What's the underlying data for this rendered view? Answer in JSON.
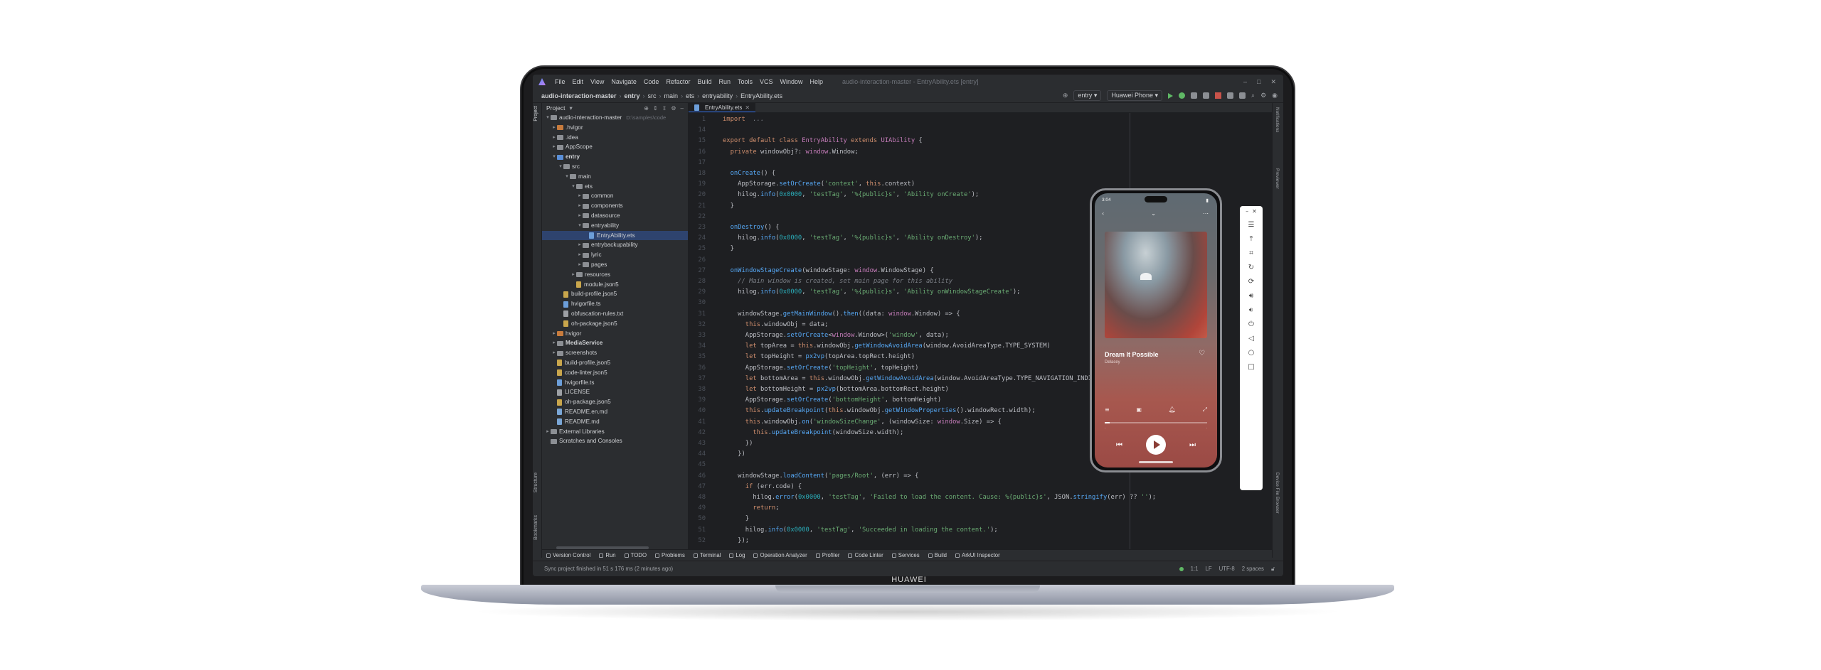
{
  "ide": {
    "menu": [
      "File",
      "Edit",
      "View",
      "Navigate",
      "Code",
      "Refactor",
      "Build",
      "Run",
      "Tools",
      "VCS",
      "Window",
      "Help"
    ],
    "window_title": "audio-interaction-master - EntryAbility.ets [entry]",
    "breadcrumb": [
      "audio-interaction-master",
      "entry",
      "src",
      "main",
      "ets",
      "entryability",
      "EntryAbility.ets"
    ],
    "run_config": "entry",
    "device": "Huawei Phone",
    "project_label": "Project",
    "tab_label": "EntryAbility.ets"
  },
  "tree": [
    {
      "indent": 0,
      "chev": "v",
      "icon": "folder",
      "label": "audio-interaction-master",
      "hint": "D:\\samples\\code"
    },
    {
      "indent": 1,
      "chev": ">",
      "icon": "folder-orange",
      "label": ".hvigor"
    },
    {
      "indent": 1,
      "chev": ">",
      "icon": "folder",
      "label": ".idea"
    },
    {
      "indent": 1,
      "chev": ">",
      "icon": "folder",
      "label": "AppScope"
    },
    {
      "indent": 1,
      "chev": "v",
      "icon": "folder-blue",
      "label": "entry"
    },
    {
      "indent": 2,
      "chev": "v",
      "icon": "folder",
      "label": "src"
    },
    {
      "indent": 3,
      "chev": "v",
      "icon": "folder",
      "label": "main"
    },
    {
      "indent": 4,
      "chev": "v",
      "icon": "folder",
      "label": "ets"
    },
    {
      "indent": 5,
      "chev": ">",
      "icon": "folder",
      "label": "common"
    },
    {
      "indent": 5,
      "chev": ">",
      "icon": "folder",
      "label": "components"
    },
    {
      "indent": 5,
      "chev": ">",
      "icon": "folder",
      "label": "datasource"
    },
    {
      "indent": 5,
      "chev": "v",
      "icon": "folder",
      "label": "entryability"
    },
    {
      "indent": 6,
      "chev": "",
      "icon": "file",
      "label": "EntryAbility.ets",
      "selected": true
    },
    {
      "indent": 5,
      "chev": ">",
      "icon": "folder",
      "label": "entrybackupability"
    },
    {
      "indent": 5,
      "chev": ">",
      "icon": "folder",
      "label": "lyric"
    },
    {
      "indent": 5,
      "chev": ">",
      "icon": "folder",
      "label": "pages"
    },
    {
      "indent": 4,
      "chev": ">",
      "icon": "folder",
      "label": "resources"
    },
    {
      "indent": 4,
      "chev": "",
      "icon": "json",
      "label": "module.json5"
    },
    {
      "indent": 2,
      "chev": "",
      "icon": "json",
      "label": "build-profile.json5"
    },
    {
      "indent": 2,
      "chev": "",
      "icon": "file",
      "label": "hvigorfile.ts"
    },
    {
      "indent": 2,
      "chev": "",
      "icon": "txt",
      "label": "obfuscation-rules.txt"
    },
    {
      "indent": 2,
      "chev": "",
      "icon": "json",
      "label": "oh-package.json5"
    },
    {
      "indent": 1,
      "chev": ">",
      "icon": "folder-orange",
      "label": "hvigor"
    },
    {
      "indent": 1,
      "chev": ">",
      "icon": "folder",
      "label": "MediaService"
    },
    {
      "indent": 1,
      "chev": ">",
      "icon": "folder",
      "label": "screenshots"
    },
    {
      "indent": 1,
      "chev": "",
      "icon": "json",
      "label": "build-profile.json5"
    },
    {
      "indent": 1,
      "chev": "",
      "icon": "json",
      "label": "code-linter.json5"
    },
    {
      "indent": 1,
      "chev": "",
      "icon": "file",
      "label": "hvigorfile.ts"
    },
    {
      "indent": 1,
      "chev": "",
      "icon": "txt",
      "label": "LICENSE"
    },
    {
      "indent": 1,
      "chev": "",
      "icon": "json",
      "label": "oh-package.json5"
    },
    {
      "indent": 1,
      "chev": "",
      "icon": "md",
      "label": "README.en.md"
    },
    {
      "indent": 1,
      "chev": "",
      "icon": "md",
      "label": "README.md"
    },
    {
      "indent": 0,
      "chev": ">",
      "icon": "folder",
      "label": "External Libraries"
    },
    {
      "indent": 0,
      "chev": "",
      "icon": "folder",
      "label": "Scratches and Consoles"
    }
  ],
  "code": [
    {
      "n": "",
      "t": [
        [
          "kw",
          "import"
        ],
        [
          "",
          "  "
        ],
        [
          "cmt",
          "..."
        ]
      ]
    },
    {
      "n": "",
      "t": []
    },
    {
      "n": "",
      "t": [
        [
          "kw",
          "export default class "
        ],
        [
          "typ",
          "EntryAbility "
        ],
        [
          "kw",
          "extends "
        ],
        [
          "typ",
          "UIAbility"
        ],
        [
          "",
          " {"
        ]
      ]
    },
    {
      "n": "",
      "t": [
        [
          "",
          "  "
        ],
        [
          "kw",
          "private "
        ],
        [
          "",
          "windowObj?: "
        ],
        [
          "typ",
          "window"
        ],
        [
          "",
          ".Window;"
        ]
      ]
    },
    {
      "n": "",
      "t": []
    },
    {
      "n": "",
      "t": [
        [
          "",
          "  "
        ],
        [
          "fn",
          "onCreate"
        ],
        [
          "",
          "() {"
        ]
      ]
    },
    {
      "n": "",
      "t": [
        [
          "",
          "    AppStorage."
        ],
        [
          "fn",
          "setOrCreate"
        ],
        [
          "",
          "("
        ],
        [
          "str",
          "'context'"
        ],
        [
          "",
          ", "
        ],
        [
          "kw",
          "this"
        ],
        [
          "",
          ".context)"
        ]
      ]
    },
    {
      "n": "",
      "t": [
        [
          "",
          "    hilog."
        ],
        [
          "fn",
          "info"
        ],
        [
          "",
          "("
        ],
        [
          "num",
          "0x0000"
        ],
        [
          "",
          ", "
        ],
        [
          "str",
          "'testTag'"
        ],
        [
          "",
          ", "
        ],
        [
          "str",
          "'%{public}s'"
        ],
        [
          "",
          ", "
        ],
        [
          "str",
          "'Ability onCreate'"
        ],
        [
          "",
          ");"
        ]
      ]
    },
    {
      "n": "",
      "t": [
        [
          "",
          "  }"
        ]
      ]
    },
    {
      "n": "",
      "t": []
    },
    {
      "n": "",
      "t": [
        [
          "",
          "  "
        ],
        [
          "fn",
          "onDestroy"
        ],
        [
          "",
          "() {"
        ]
      ]
    },
    {
      "n": "",
      "t": [
        [
          "",
          "    hilog."
        ],
        [
          "fn",
          "info"
        ],
        [
          "",
          "("
        ],
        [
          "num",
          "0x0000"
        ],
        [
          "",
          ", "
        ],
        [
          "str",
          "'testTag'"
        ],
        [
          "",
          ", "
        ],
        [
          "str",
          "'%{public}s'"
        ],
        [
          "",
          ", "
        ],
        [
          "str",
          "'Ability onDestroy'"
        ],
        [
          "",
          ");"
        ]
      ]
    },
    {
      "n": "",
      "t": [
        [
          "",
          "  }"
        ]
      ]
    },
    {
      "n": "",
      "t": []
    },
    {
      "n": "",
      "t": [
        [
          "",
          "  "
        ],
        [
          "fn",
          "onWindowStageCreate"
        ],
        [
          "",
          "(windowStage: "
        ],
        [
          "typ",
          "window"
        ],
        [
          "",
          ".WindowStage) {"
        ]
      ]
    },
    {
      "n": "",
      "t": [
        [
          "cmt",
          "    // Main window is created, set main page for this ability"
        ]
      ]
    },
    {
      "n": "",
      "t": [
        [
          "",
          "    hilog."
        ],
        [
          "fn",
          "info"
        ],
        [
          "",
          "("
        ],
        [
          "num",
          "0x0000"
        ],
        [
          "",
          ", "
        ],
        [
          "str",
          "'testTag'"
        ],
        [
          "",
          ", "
        ],
        [
          "str",
          "'%{public}s'"
        ],
        [
          "",
          ", "
        ],
        [
          "str",
          "'Ability onWindowStageCreate'"
        ],
        [
          "",
          ");"
        ]
      ]
    },
    {
      "n": "",
      "t": []
    },
    {
      "n": "",
      "t": [
        [
          "",
          "    windowStage."
        ],
        [
          "fn",
          "getMainWindow"
        ],
        [
          "",
          "()."
        ],
        [
          "fn",
          "then"
        ],
        [
          "",
          "((data: "
        ],
        [
          "typ",
          "window"
        ],
        [
          "",
          ".Window) => {"
        ]
      ]
    },
    {
      "n": "",
      "t": [
        [
          "",
          "      "
        ],
        [
          "kw",
          "this"
        ],
        [
          "",
          ".windowObj = data;"
        ]
      ]
    },
    {
      "n": "",
      "t": [
        [
          "",
          "      AppStorage."
        ],
        [
          "fn",
          "setOrCreate"
        ],
        [
          "",
          "<"
        ],
        [
          "typ",
          "window"
        ],
        [
          "",
          ".Window>("
        ],
        [
          "str",
          "'window'"
        ],
        [
          "",
          ", data);"
        ]
      ]
    },
    {
      "n": "",
      "t": [
        [
          "",
          "      "
        ],
        [
          "kw",
          "let "
        ],
        [
          "",
          "topArea = "
        ],
        [
          "kw",
          "this"
        ],
        [
          "",
          ".windowObj."
        ],
        [
          "fn",
          "getWindowAvoidArea"
        ],
        [
          "",
          "(window.AvoidAreaType.TYPE_SYSTEM)"
        ]
      ]
    },
    {
      "n": "",
      "t": [
        [
          "",
          "      "
        ],
        [
          "kw",
          "let "
        ],
        [
          "",
          "topHeight = "
        ],
        [
          "fn",
          "px2vp"
        ],
        [
          "",
          "(topArea.topRect.height)"
        ]
      ]
    },
    {
      "n": "",
      "t": [
        [
          "",
          "      AppStorage."
        ],
        [
          "fn",
          "setOrCreate"
        ],
        [
          "",
          "("
        ],
        [
          "str",
          "'topHeight'"
        ],
        [
          "",
          ", topHeight)"
        ]
      ]
    },
    {
      "n": "",
      "t": [
        [
          "",
          "      "
        ],
        [
          "kw",
          "let "
        ],
        [
          "",
          "bottomArea = "
        ],
        [
          "kw",
          "this"
        ],
        [
          "",
          ".windowObj."
        ],
        [
          "fn",
          "getWindowAvoidArea"
        ],
        [
          "",
          "(window.AvoidAreaType.TYPE_NAVIGATION_INDICATOR)"
        ]
      ]
    },
    {
      "n": "",
      "t": [
        [
          "",
          "      "
        ],
        [
          "kw",
          "let "
        ],
        [
          "",
          "bottomHeight = "
        ],
        [
          "fn",
          "px2vp"
        ],
        [
          "",
          "(bottomArea.bottomRect.height)"
        ]
      ]
    },
    {
      "n": "",
      "t": [
        [
          "",
          "      AppStorage."
        ],
        [
          "fn",
          "setOrCreate"
        ],
        [
          "",
          "("
        ],
        [
          "str",
          "'bottomHeight'"
        ],
        [
          "",
          ", bottomHeight)"
        ]
      ]
    },
    {
      "n": "",
      "t": [
        [
          "",
          "      "
        ],
        [
          "kw",
          "this"
        ],
        [
          "",
          "."
        ],
        [
          "fn",
          "updateBreakpoint"
        ],
        [
          "",
          "("
        ],
        [
          "kw",
          "this"
        ],
        [
          "",
          ".windowObj."
        ],
        [
          "fn",
          "getWindowProperties"
        ],
        [
          "",
          "().windowRect.width);"
        ]
      ]
    },
    {
      "n": "",
      "t": [
        [
          "",
          "      "
        ],
        [
          "kw",
          "this"
        ],
        [
          "",
          ".windowObj."
        ],
        [
          "fn",
          "on"
        ],
        [
          "",
          "("
        ],
        [
          "str",
          "'windowSizeChange'"
        ],
        [
          "",
          ", (windowSize: "
        ],
        [
          "typ",
          "window"
        ],
        [
          "",
          ".Size) => {"
        ]
      ]
    },
    {
      "n": "",
      "t": [
        [
          "",
          "        "
        ],
        [
          "kw",
          "this"
        ],
        [
          "",
          "."
        ],
        [
          "fn",
          "updateBreakpoint"
        ],
        [
          "",
          "(windowSize.width);"
        ]
      ]
    },
    {
      "n": "",
      "t": [
        [
          "",
          "      })"
        ]
      ]
    },
    {
      "n": "",
      "t": [
        [
          "",
          "    })"
        ]
      ]
    },
    {
      "n": "",
      "t": []
    },
    {
      "n": "",
      "t": [
        [
          "",
          "    windowStage."
        ],
        [
          "fn",
          "loadContent"
        ],
        [
          "",
          "("
        ],
        [
          "str",
          "'pages/Root'"
        ],
        [
          "",
          ", (err) => {"
        ]
      ]
    },
    {
      "n": "",
      "t": [
        [
          "",
          "      "
        ],
        [
          "kw",
          "if "
        ],
        [
          "",
          "(err.code) {"
        ]
      ]
    },
    {
      "n": "",
      "t": [
        [
          "",
          "        hilog."
        ],
        [
          "fn",
          "error"
        ],
        [
          "",
          "("
        ],
        [
          "num",
          "0x0000"
        ],
        [
          "",
          ", "
        ],
        [
          "str",
          "'testTag'"
        ],
        [
          "",
          ", "
        ],
        [
          "str",
          "'Failed to load the content. Cause: %{public}s'"
        ],
        [
          "",
          ", JSON."
        ],
        [
          "fn",
          "stringify"
        ],
        [
          "",
          "(err) ?? "
        ],
        [
          "str",
          "''"
        ],
        [
          "",
          ");"
        ]
      ]
    },
    {
      "n": "",
      "t": [
        [
          "",
          "        "
        ],
        [
          "kw",
          "return"
        ],
        [
          "",
          ";"
        ]
      ]
    },
    {
      "n": "",
      "t": [
        [
          "",
          "      }"
        ]
      ]
    },
    {
      "n": "",
      "t": [
        [
          "",
          "      hilog."
        ],
        [
          "fn",
          "info"
        ],
        [
          "",
          "("
        ],
        [
          "num",
          "0x0000"
        ],
        [
          "",
          ", "
        ],
        [
          "str",
          "'testTag'"
        ],
        [
          "",
          ", "
        ],
        [
          "str",
          "'Succeeded in loading the content.'"
        ],
        [
          "",
          ");"
        ]
      ]
    },
    {
      "n": "",
      "t": [
        [
          "",
          "    });"
        ]
      ]
    }
  ],
  "line_numbers": [
    "1",
    "14",
    "15",
    "16",
    "17",
    "18",
    "19",
    "20",
    "21",
    "22",
    "23",
    "24",
    "25",
    "26",
    "27",
    "28",
    "29",
    "30",
    "31",
    "32",
    "33",
    "34",
    "35",
    "36",
    "37",
    "38",
    "39",
    "40",
    "41",
    "42",
    "43",
    "44",
    "45",
    "46",
    "47",
    "48",
    "49",
    "50",
    "51",
    "52"
  ],
  "bottom_tools": [
    "Version Control",
    "Run",
    "TODO",
    "Problems",
    "Terminal",
    "Log",
    "Operation Analyzer",
    "Profiler",
    "Code Linter",
    "Services",
    "Build",
    "ArkUI Inspector"
  ],
  "status": {
    "message": "Sync project finished in 51 s 176 ms (2 minutes ago)",
    "position": "1:1",
    "line_sep": "LF",
    "encoding": "UTF-8",
    "indent": "2 spaces"
  },
  "left_tabs": [
    "Project",
    "Structure",
    "Bookmarks"
  ],
  "right_tabs": [
    "Notifications",
    "Previewer",
    "Device File Browser"
  ],
  "phone": {
    "time": "3:04",
    "song_title": "Dream It Possible",
    "artist": "Delacey",
    "progress": 0.05
  },
  "brand": "HUAWEI",
  "colors": {
    "accent": "#3574f0",
    "editor_bg": "#1e1f22",
    "panel_bg": "#2b2d30",
    "selection": "#2e436e"
  }
}
